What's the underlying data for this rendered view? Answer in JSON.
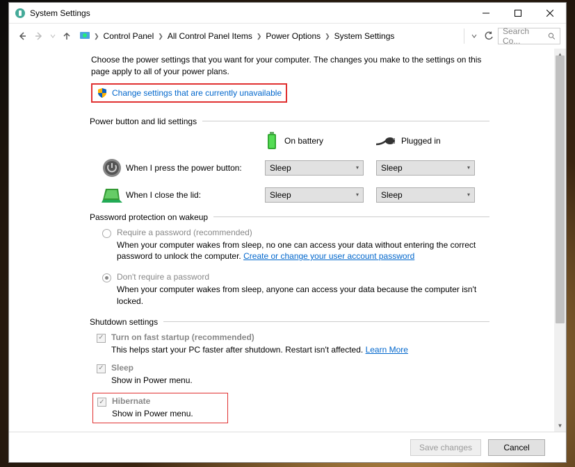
{
  "window": {
    "title": "System Settings"
  },
  "breadcrumb": [
    "Control Panel",
    "All Control Panel Items",
    "Power Options",
    "System Settings"
  ],
  "search": {
    "placeholder": "Search Co..."
  },
  "intro": "Choose the power settings that you want for your computer. The changes you make to the settings on this page apply to all of your power plans.",
  "change_link": "Change settings that are currently unavailable",
  "sections": {
    "power_lid": {
      "header": "Power button and lid settings",
      "col_battery": "On battery",
      "col_plugged": "Plugged in",
      "row_power_button": "When I press the power button:",
      "row_close_lid": "When I close the lid:",
      "selects": {
        "pb_batt": "Sleep",
        "pb_plug": "Sleep",
        "lid_batt": "Sleep",
        "lid_plug": "Sleep"
      }
    },
    "password": {
      "header": "Password protection on wakeup",
      "require": {
        "label": "Require a password (recommended)",
        "desc_pre": "When your computer wakes from sleep, no one can access your data without entering the correct password to unlock the computer. ",
        "link": "Create or change your user account password"
      },
      "dont_require": {
        "label": "Don't require a password",
        "desc": "When your computer wakes from sleep, anyone can access your data because the computer isn't locked."
      }
    },
    "shutdown": {
      "header": "Shutdown settings",
      "fast_startup": {
        "label": "Turn on fast startup (recommended)",
        "desc_pre": "This helps start your PC faster after shutdown. Restart isn't affected. ",
        "link": "Learn More"
      },
      "sleep": {
        "label": "Sleep",
        "desc": "Show in Power menu."
      },
      "hibernate": {
        "label": "Hibernate",
        "desc": "Show in Power menu."
      }
    }
  },
  "footer": {
    "save": "Save changes",
    "cancel": "Cancel"
  }
}
